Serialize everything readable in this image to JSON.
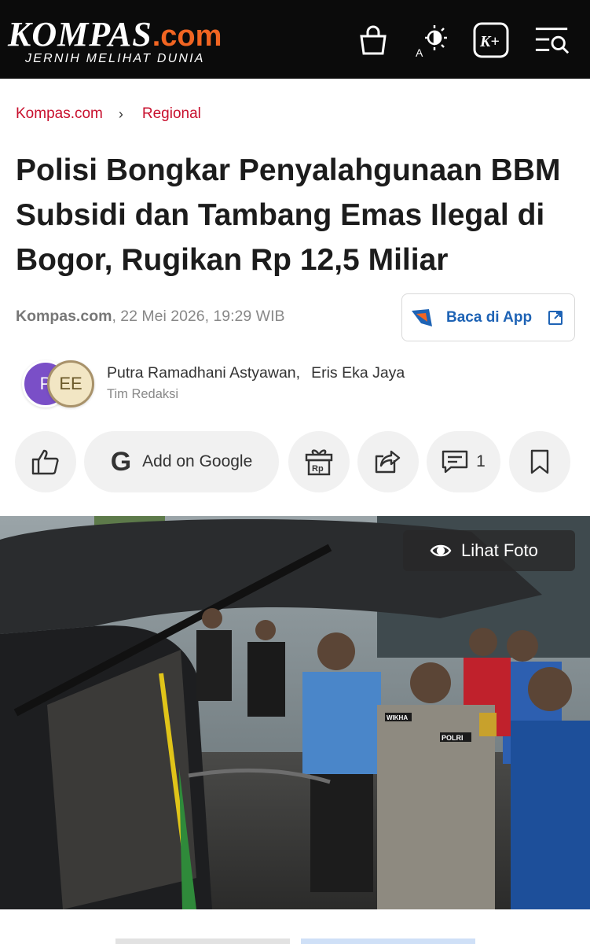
{
  "header": {
    "logo_main": "KOMPAS",
    "logo_suffix": ".com",
    "tagline": "JERNIH MELIHAT DUNIA",
    "icons": [
      "shopping-bag-icon",
      "display-mode-icon",
      "kompas-plus-icon",
      "menu-search-icon"
    ],
    "colors": {
      "background": "#0b0b0b",
      "brand_accent": "#f26522"
    }
  },
  "breadcrumb": {
    "items": [
      "Kompas.com",
      "Regional"
    ],
    "separator": "›",
    "color": "#c8102e"
  },
  "article": {
    "title": "Polisi Bongkar Penyalahgunaan BBM Subsidi dan Tambang Emas Ilegal di Bogor, Rugikan Rp 12,5 Miliar",
    "source": "Kompas.com",
    "date": ", 22 Mei 2026, 19:29 WIB",
    "app_button": "Baca di App",
    "authors": [
      "Putra Ramadhani Astyawan,",
      "Eris Eka Jaya"
    ],
    "team": "Tim Redaksi",
    "avatar_initials": [
      "P",
      "EE"
    ]
  },
  "actions": {
    "google_label": "Add on Google",
    "google_glyph": "G",
    "comment_count": "1",
    "icons": [
      "thumbs-up-icon",
      "google-icon",
      "gift-rp-icon",
      "share-icon",
      "comment-icon",
      "bookmark-icon"
    ],
    "gift_label": "Rp"
  },
  "photo": {
    "lihat_label": "Lihat Foto",
    "badge_text": [
      "WIKHA",
      "POLRI"
    ]
  }
}
